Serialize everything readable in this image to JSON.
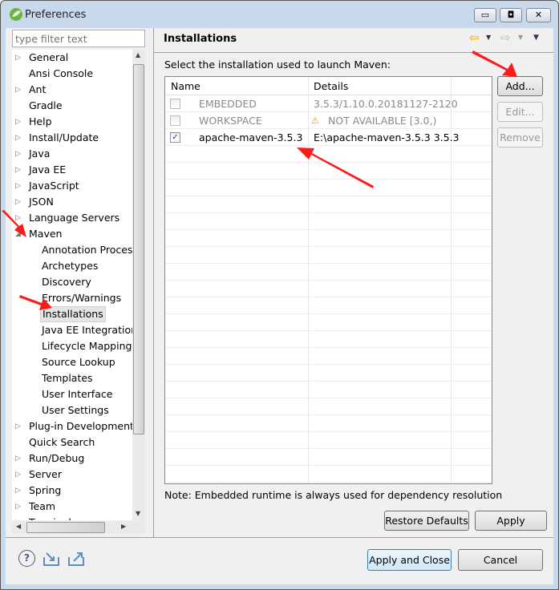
{
  "window": {
    "title": "Preferences",
    "minimize": "▭",
    "maximize": "◘",
    "close": "✕"
  },
  "filter": {
    "placeholder": "type filter text"
  },
  "tree": [
    {
      "label": "General",
      "expander": "▷",
      "level": 0
    },
    {
      "label": "Ansi Console",
      "expander": "",
      "level": 0
    },
    {
      "label": "Ant",
      "expander": "▷",
      "level": 0
    },
    {
      "label": "Gradle",
      "expander": "",
      "level": 0
    },
    {
      "label": "Help",
      "expander": "▷",
      "level": 0
    },
    {
      "label": "Install/Update",
      "expander": "▷",
      "level": 0
    },
    {
      "label": "Java",
      "expander": "▷",
      "level": 0
    },
    {
      "label": "Java EE",
      "expander": "▷",
      "level": 0
    },
    {
      "label": "JavaScript",
      "expander": "▷",
      "level": 0
    },
    {
      "label": "JSON",
      "expander": "▷",
      "level": 0
    },
    {
      "label": "Language Servers",
      "expander": "▷",
      "level": 0
    },
    {
      "label": "Maven",
      "expander": "◢",
      "level": 0
    },
    {
      "label": "Annotation Processing",
      "expander": "",
      "level": 1
    },
    {
      "label": "Archetypes",
      "expander": "",
      "level": 1
    },
    {
      "label": "Discovery",
      "expander": "",
      "level": 1
    },
    {
      "label": "Errors/Warnings",
      "expander": "",
      "level": 1
    },
    {
      "label": "Installations",
      "expander": "",
      "level": 1,
      "selected": true
    },
    {
      "label": "Java EE Integration",
      "expander": "",
      "level": 1
    },
    {
      "label": "Lifecycle Mappings",
      "expander": "",
      "level": 1
    },
    {
      "label": "Source Lookup",
      "expander": "",
      "level": 1
    },
    {
      "label": "Templates",
      "expander": "",
      "level": 1
    },
    {
      "label": "User Interface",
      "expander": "",
      "level": 1
    },
    {
      "label": "User Settings",
      "expander": "",
      "level": 1
    },
    {
      "label": "Plug-in Development",
      "expander": "▷",
      "level": 0
    },
    {
      "label": "Quick Search",
      "expander": "",
      "level": 0
    },
    {
      "label": "Run/Debug",
      "expander": "▷",
      "level": 0
    },
    {
      "label": "Server",
      "expander": "▷",
      "level": 0
    },
    {
      "label": "Spring",
      "expander": "▷",
      "level": 0
    },
    {
      "label": "Team",
      "expander": "▷",
      "level": 0
    },
    {
      "label": "Terminal",
      "expander": "▷",
      "level": 0
    }
  ],
  "page": {
    "title": "Installations",
    "instruction": "Select the installation used to launch Maven:",
    "columns": [
      "Name",
      "Details"
    ],
    "rows": [
      {
        "checked": false,
        "name": "EMBEDDED",
        "details": "3.5.3/1.10.0.20181127-2120",
        "disabled": true,
        "warning": false
      },
      {
        "checked": false,
        "name": "WORKSPACE",
        "details": "NOT AVAILABLE [3.0,)",
        "disabled": true,
        "warning": true
      },
      {
        "checked": true,
        "name": "apache-maven-3.5.3",
        "details": "E:\\apache-maven-3.5.3 3.5.3",
        "disabled": false,
        "warning": false
      }
    ],
    "buttons": {
      "add": "Add...",
      "edit": "Edit...",
      "remove": "Remove"
    },
    "note": "Note: Embedded runtime is always used for dependency resolution",
    "restore_defaults": "Restore Defaults",
    "apply": "Apply"
  },
  "footer": {
    "apply_close": "Apply and Close",
    "cancel": "Cancel",
    "help": "?"
  },
  "colors": {
    "annotation_arrow": "#ff1a1a",
    "selection": "#e5e5e5",
    "focus_border": "#3c7fb1"
  }
}
